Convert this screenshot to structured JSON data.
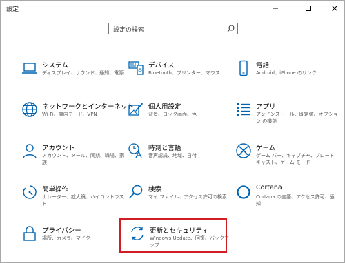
{
  "window": {
    "title": "設定",
    "controls": [
      "minimize-icon",
      "maximize-icon",
      "close-icon"
    ]
  },
  "search": {
    "placeholder": "設定の検索",
    "icon": "search-icon"
  },
  "accent_color": "#0063b1",
  "highlight_color": "#d21d25",
  "tiles": [
    {
      "title": "システム",
      "desc": "ディスプレイ、サウンド、通知、電源",
      "icon": "laptop-icon"
    },
    {
      "title": "デバイス",
      "desc": "Bluetooth、プリンター、マウス",
      "icon": "keyboard-icon"
    },
    {
      "title": "電話",
      "desc": "Android、iPhone のリンク",
      "icon": "phone-icon"
    },
    {
      "title": "ネットワークとインターネット",
      "desc": "Wi-Fi、機内モード、VPN",
      "icon": "globe-icon"
    },
    {
      "title": "個人用設定",
      "desc": "背景、ロック画面、色",
      "icon": "paint-icon"
    },
    {
      "title": "アプリ",
      "desc": "アンインストール、既定値、オプション の機能",
      "icon": "apps-icon"
    },
    {
      "title": "アカウント",
      "desc": "アカウント、メール、同期、職場、家族",
      "icon": "person-icon"
    },
    {
      "title": "時刻と言語",
      "desc": "音声認識、地域、日付",
      "icon": "time-language-icon"
    },
    {
      "title": "ゲーム",
      "desc": "ゲーム バー、キャプチャ、ブロードキャスト、ゲーム モード",
      "icon": "xbox-icon"
    },
    {
      "title": "簡単操作",
      "desc": "ナレーター、拡大鏡、ハイコントラスト",
      "icon": "ease-of-access-icon"
    },
    {
      "title": "検索",
      "desc": "マイ ファイル、アクセス許可の検索",
      "icon": "search-icon"
    },
    {
      "title": "Cortana",
      "desc": "Cortana の言語、アクセス許可、通知",
      "icon": "cortana-icon"
    },
    {
      "title": "プライバシー",
      "desc": "場所、カメラ、マイク",
      "icon": "lock-icon"
    },
    {
      "title": "更新とセキュリティ",
      "desc": "Windows Update、回復、バックアップ",
      "icon": "update-icon"
    }
  ]
}
